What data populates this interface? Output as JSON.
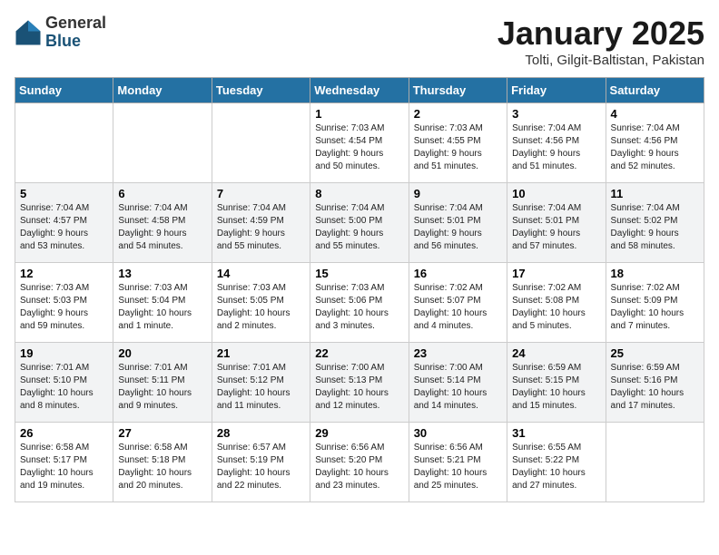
{
  "header": {
    "logo_general": "General",
    "logo_blue": "Blue",
    "month_title": "January 2025",
    "location": "Tolti, Gilgit-Baltistan, Pakistan"
  },
  "days_of_week": [
    "Sunday",
    "Monday",
    "Tuesday",
    "Wednesday",
    "Thursday",
    "Friday",
    "Saturday"
  ],
  "weeks": [
    {
      "shaded": false,
      "days": [
        {
          "num": "",
          "info": ""
        },
        {
          "num": "",
          "info": ""
        },
        {
          "num": "",
          "info": ""
        },
        {
          "num": "1",
          "info": "Sunrise: 7:03 AM\nSunset: 4:54 PM\nDaylight: 9 hours\nand 50 minutes."
        },
        {
          "num": "2",
          "info": "Sunrise: 7:03 AM\nSunset: 4:55 PM\nDaylight: 9 hours\nand 51 minutes."
        },
        {
          "num": "3",
          "info": "Sunrise: 7:04 AM\nSunset: 4:56 PM\nDaylight: 9 hours\nand 51 minutes."
        },
        {
          "num": "4",
          "info": "Sunrise: 7:04 AM\nSunset: 4:56 PM\nDaylight: 9 hours\nand 52 minutes."
        }
      ]
    },
    {
      "shaded": true,
      "days": [
        {
          "num": "5",
          "info": "Sunrise: 7:04 AM\nSunset: 4:57 PM\nDaylight: 9 hours\nand 53 minutes."
        },
        {
          "num": "6",
          "info": "Sunrise: 7:04 AM\nSunset: 4:58 PM\nDaylight: 9 hours\nand 54 minutes."
        },
        {
          "num": "7",
          "info": "Sunrise: 7:04 AM\nSunset: 4:59 PM\nDaylight: 9 hours\nand 55 minutes."
        },
        {
          "num": "8",
          "info": "Sunrise: 7:04 AM\nSunset: 5:00 PM\nDaylight: 9 hours\nand 55 minutes."
        },
        {
          "num": "9",
          "info": "Sunrise: 7:04 AM\nSunset: 5:01 PM\nDaylight: 9 hours\nand 56 minutes."
        },
        {
          "num": "10",
          "info": "Sunrise: 7:04 AM\nSunset: 5:01 PM\nDaylight: 9 hours\nand 57 minutes."
        },
        {
          "num": "11",
          "info": "Sunrise: 7:04 AM\nSunset: 5:02 PM\nDaylight: 9 hours\nand 58 minutes."
        }
      ]
    },
    {
      "shaded": false,
      "days": [
        {
          "num": "12",
          "info": "Sunrise: 7:03 AM\nSunset: 5:03 PM\nDaylight: 9 hours\nand 59 minutes."
        },
        {
          "num": "13",
          "info": "Sunrise: 7:03 AM\nSunset: 5:04 PM\nDaylight: 10 hours\nand 1 minute."
        },
        {
          "num": "14",
          "info": "Sunrise: 7:03 AM\nSunset: 5:05 PM\nDaylight: 10 hours\nand 2 minutes."
        },
        {
          "num": "15",
          "info": "Sunrise: 7:03 AM\nSunset: 5:06 PM\nDaylight: 10 hours\nand 3 minutes."
        },
        {
          "num": "16",
          "info": "Sunrise: 7:02 AM\nSunset: 5:07 PM\nDaylight: 10 hours\nand 4 minutes."
        },
        {
          "num": "17",
          "info": "Sunrise: 7:02 AM\nSunset: 5:08 PM\nDaylight: 10 hours\nand 5 minutes."
        },
        {
          "num": "18",
          "info": "Sunrise: 7:02 AM\nSunset: 5:09 PM\nDaylight: 10 hours\nand 7 minutes."
        }
      ]
    },
    {
      "shaded": true,
      "days": [
        {
          "num": "19",
          "info": "Sunrise: 7:01 AM\nSunset: 5:10 PM\nDaylight: 10 hours\nand 8 minutes."
        },
        {
          "num": "20",
          "info": "Sunrise: 7:01 AM\nSunset: 5:11 PM\nDaylight: 10 hours\nand 9 minutes."
        },
        {
          "num": "21",
          "info": "Sunrise: 7:01 AM\nSunset: 5:12 PM\nDaylight: 10 hours\nand 11 minutes."
        },
        {
          "num": "22",
          "info": "Sunrise: 7:00 AM\nSunset: 5:13 PM\nDaylight: 10 hours\nand 12 minutes."
        },
        {
          "num": "23",
          "info": "Sunrise: 7:00 AM\nSunset: 5:14 PM\nDaylight: 10 hours\nand 14 minutes."
        },
        {
          "num": "24",
          "info": "Sunrise: 6:59 AM\nSunset: 5:15 PM\nDaylight: 10 hours\nand 15 minutes."
        },
        {
          "num": "25",
          "info": "Sunrise: 6:59 AM\nSunset: 5:16 PM\nDaylight: 10 hours\nand 17 minutes."
        }
      ]
    },
    {
      "shaded": false,
      "days": [
        {
          "num": "26",
          "info": "Sunrise: 6:58 AM\nSunset: 5:17 PM\nDaylight: 10 hours\nand 19 minutes."
        },
        {
          "num": "27",
          "info": "Sunrise: 6:58 AM\nSunset: 5:18 PM\nDaylight: 10 hours\nand 20 minutes."
        },
        {
          "num": "28",
          "info": "Sunrise: 6:57 AM\nSunset: 5:19 PM\nDaylight: 10 hours\nand 22 minutes."
        },
        {
          "num": "29",
          "info": "Sunrise: 6:56 AM\nSunset: 5:20 PM\nDaylight: 10 hours\nand 23 minutes."
        },
        {
          "num": "30",
          "info": "Sunrise: 6:56 AM\nSunset: 5:21 PM\nDaylight: 10 hours\nand 25 minutes."
        },
        {
          "num": "31",
          "info": "Sunrise: 6:55 AM\nSunset: 5:22 PM\nDaylight: 10 hours\nand 27 minutes."
        },
        {
          "num": "",
          "info": ""
        }
      ]
    }
  ]
}
